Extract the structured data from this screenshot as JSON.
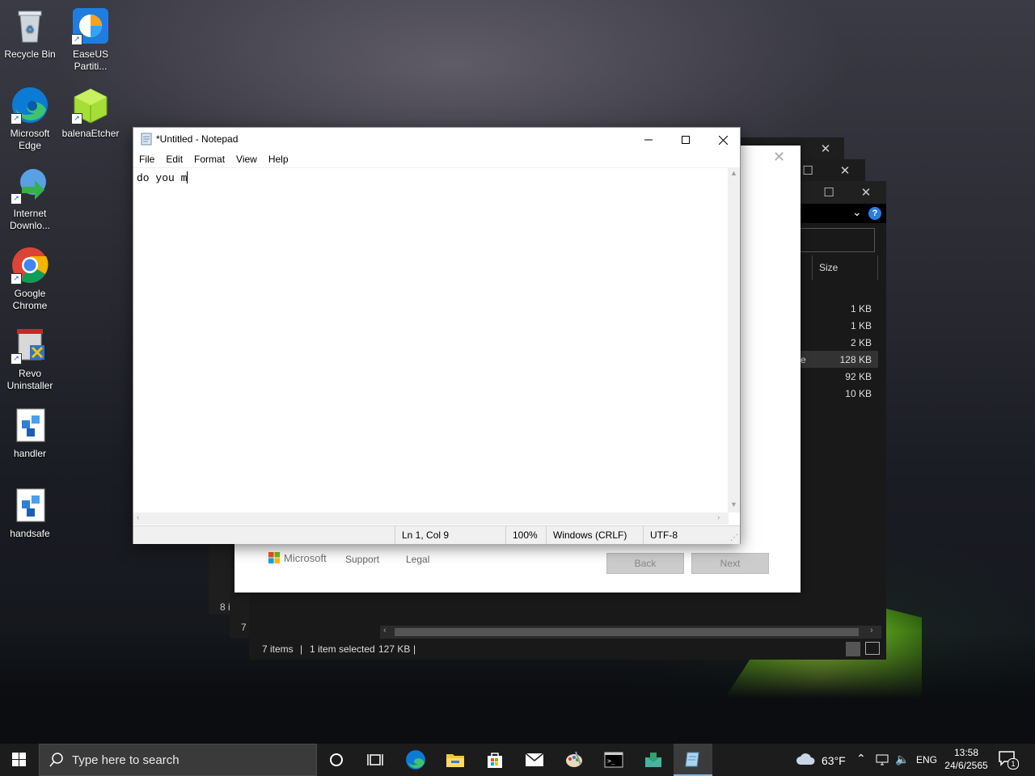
{
  "desktop": {
    "icons": [
      {
        "label": "Recycle Bin"
      },
      {
        "label": "EaseUS Partiti..."
      },
      {
        "label": "Microsoft Edge"
      },
      {
        "label": "balenaEtcher"
      },
      {
        "label": "Internet Downlo..."
      },
      {
        "label": "Google Chrome"
      },
      {
        "label": "Revo Uninstaller"
      },
      {
        "label": "handler"
      },
      {
        "label": "handsafe"
      }
    ]
  },
  "explorer": {
    "size_header": "Size",
    "rows": [
      {
        "size": "1 KB"
      },
      {
        "size": "1 KB"
      },
      {
        "size": "2 KB"
      },
      {
        "size": "128 KB",
        "partial": "e"
      },
      {
        "size": "92 KB"
      },
      {
        "size": "10 KB"
      }
    ],
    "status": {
      "items": "7 items",
      "selected": "1 item selected",
      "size": "127 KB"
    },
    "behind1_status": "8 i",
    "behind2_status": "7 i"
  },
  "setup": {
    "brand": "Microsoft",
    "support": "Support",
    "legal": "Legal",
    "back": "Back",
    "next": "Next"
  },
  "notepad": {
    "title": "*Untitled - Notepad",
    "menu": {
      "file": "File",
      "edit": "Edit",
      "format": "Format",
      "view": "View",
      "help": "Help"
    },
    "content": "do you m",
    "status": {
      "position": "Ln 1, Col 9",
      "zoom": "100%",
      "line_ending": "Windows (CRLF)",
      "encoding": "UTF-8"
    }
  },
  "taskbar": {
    "search_placeholder": "Type here to search",
    "weather": "63°F",
    "language": "ENG",
    "time": "13:58",
    "date": "24/6/2565",
    "notification_count": "1"
  },
  "colors": {
    "win_blue": "#0078d7",
    "edge_green": "#3fb54a",
    "folder_yellow": "#f0c540"
  }
}
